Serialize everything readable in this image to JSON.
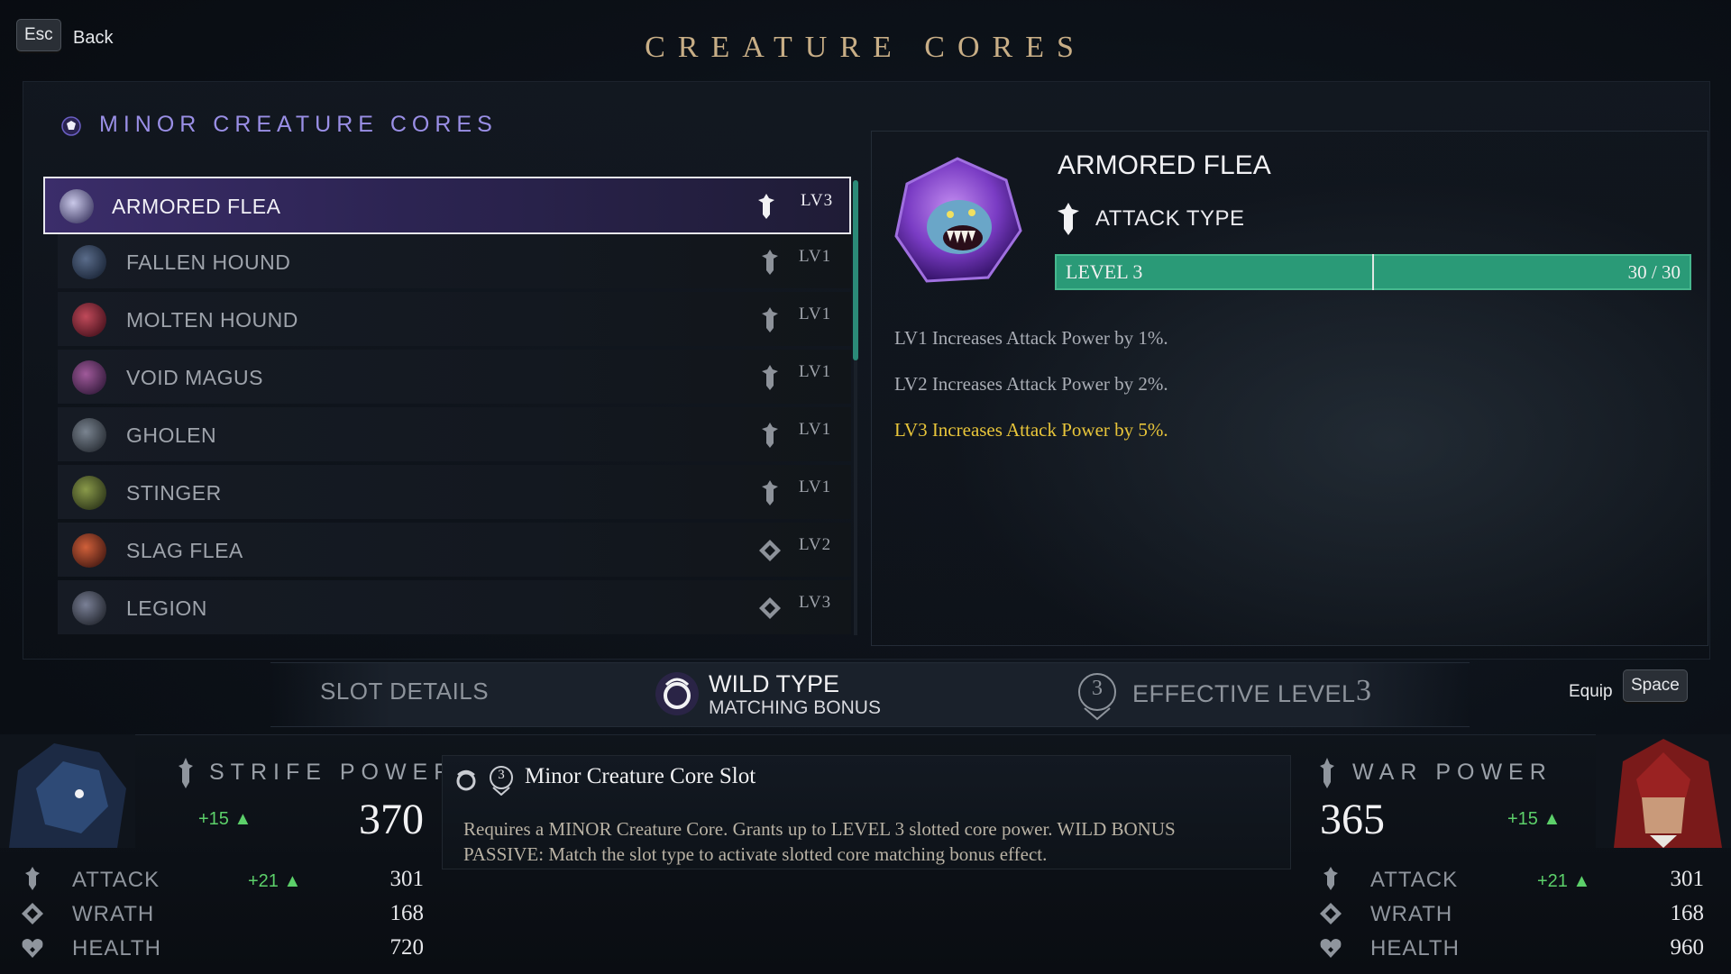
{
  "top": {
    "esc_key": "Esc",
    "back_label": "Back",
    "title": "CREATURE CORES"
  },
  "list": {
    "section_title": "MINOR CREATURE CORES",
    "items": [
      {
        "name": "ARMORED FLEA",
        "level": "LV3",
        "type_icon": "attack-type-icon",
        "selected": true,
        "color": "#8a8fb0"
      },
      {
        "name": "FALLEN HOUND",
        "level": "LV1",
        "type_icon": "attack-type-icon",
        "selected": false,
        "color": "#3b4f6e"
      },
      {
        "name": "MOLTEN HOUND",
        "level": "LV1",
        "type_icon": "attack-type-icon",
        "selected": false,
        "color": "#8a2a3a"
      },
      {
        "name": "VOID MAGUS",
        "level": "LV1",
        "type_icon": "attack-type-icon",
        "selected": false,
        "color": "#6a3a6e"
      },
      {
        "name": "GHOLEN",
        "level": "LV1",
        "type_icon": "attack-type-icon",
        "selected": false,
        "color": "#5b6470"
      },
      {
        "name": "STINGER",
        "level": "LV1",
        "type_icon": "attack-type-icon",
        "selected": false,
        "color": "#6a7a3a"
      },
      {
        "name": "SLAG FLEA",
        "level": "LV2",
        "type_icon": "wrath-type-icon",
        "selected": false,
        "color": "#9a3a2a"
      },
      {
        "name": "LEGION",
        "level": "LV3",
        "type_icon": "wrath-type-icon",
        "selected": false,
        "color": "#5a6278"
      }
    ]
  },
  "detail": {
    "name": "ARMORED FLEA",
    "type_label": "ATTACK TYPE",
    "level_label": "LEVEL 3",
    "level_value": "30 / 30",
    "progress_fraction": 1.0,
    "bonuses": [
      {
        "text": "LV1 Increases Attack Power by 1%.",
        "active": false
      },
      {
        "text": "LV2 Increases Attack Power by 2%.",
        "active": false
      },
      {
        "text": "LV3 Increases Attack Power by 5%.",
        "active": true
      }
    ]
  },
  "slot": {
    "details_label": "SLOT DETAILS",
    "wild_type": "WILD TYPE",
    "matching_bonus": "MATCHING BONUS",
    "effective_level_label": "EFFECTIVE LEVEL",
    "effective_level_value": "3",
    "effective_badge": "3",
    "equip_label": "Equip",
    "equip_key": "Space"
  },
  "strife": {
    "title": "STRIFE POWER",
    "power": "370",
    "delta": "+15 ▲",
    "stats": [
      {
        "name": "ATTACK",
        "value": "301",
        "delta": "+21 ▲",
        "icon": "attack-stat-icon"
      },
      {
        "name": "WRATH",
        "value": "168",
        "delta": "",
        "icon": "wrath-stat-icon"
      },
      {
        "name": "HEALTH",
        "value": "720",
        "delta": "",
        "icon": "health-stat-icon"
      }
    ]
  },
  "war": {
    "title": "WAR POWER",
    "power": "365",
    "delta": "+15 ▲",
    "stats": [
      {
        "name": "ATTACK",
        "value": "301",
        "delta": "+21 ▲",
        "icon": "attack-stat-icon"
      },
      {
        "name": "WRATH",
        "value": "168",
        "delta": "",
        "icon": "wrath-stat-icon"
      },
      {
        "name": "HEALTH",
        "value": "960",
        "delta": "",
        "icon": "health-stat-icon"
      }
    ]
  },
  "slot_description": {
    "title": "Minor Creature Core Slot",
    "badge": "3",
    "text": "Requires a MINOR Creature Core. Grants up to LEVEL 3 slotted core power. WILD BONUS PASSIVE: Match the slot type to activate slotted core matching bonus effect."
  }
}
